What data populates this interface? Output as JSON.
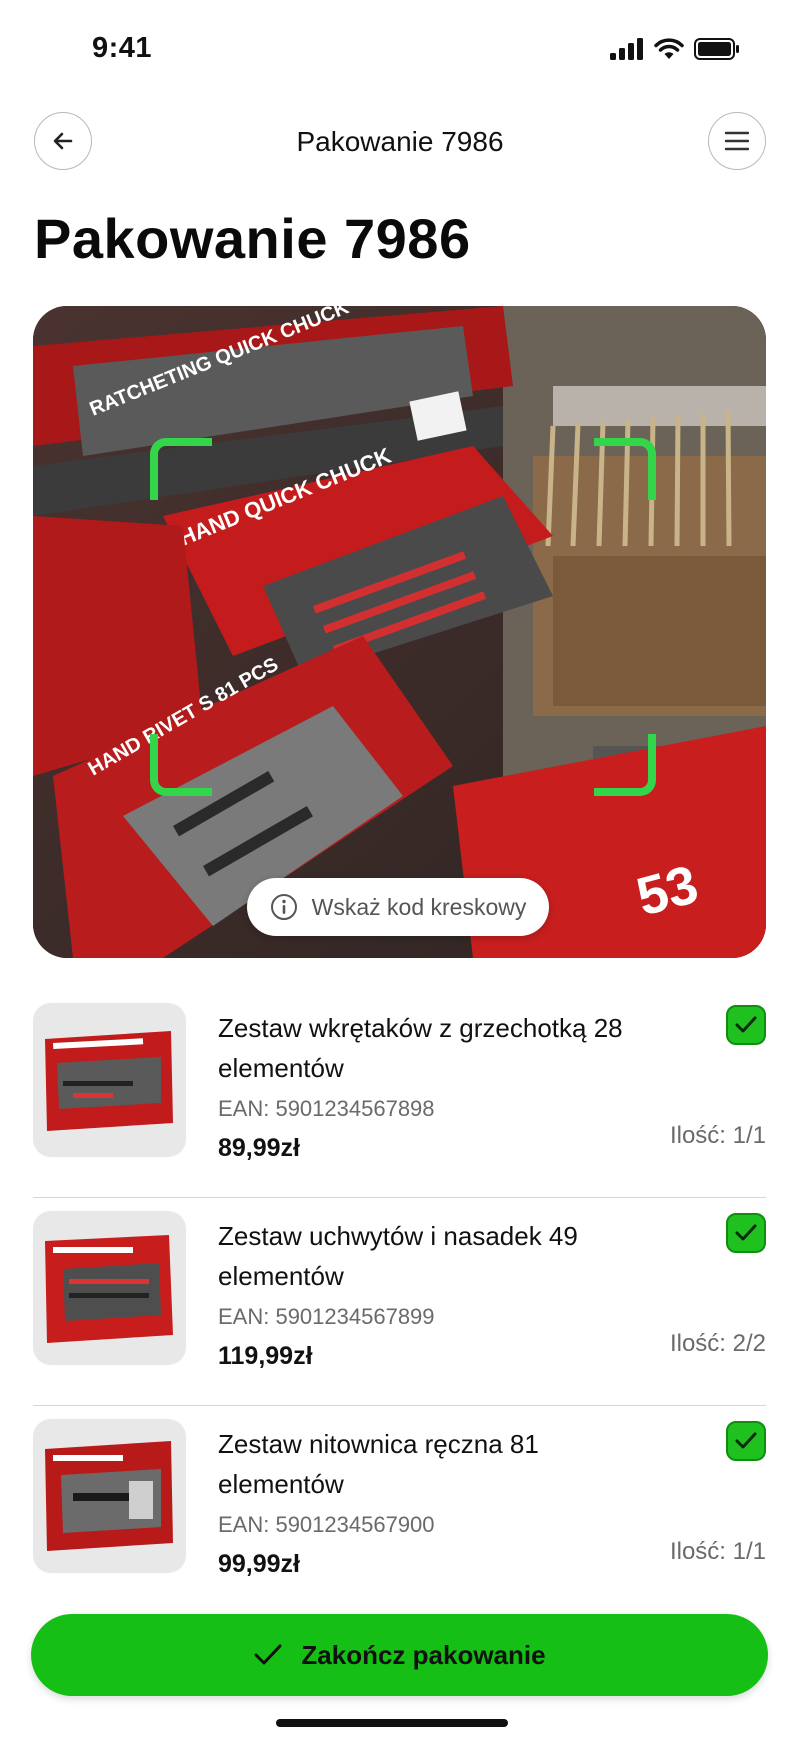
{
  "status_bar": {
    "time": "9:41"
  },
  "nav": {
    "title": "Pakowanie 7986"
  },
  "page": {
    "title": "Pakowanie 7986"
  },
  "scanner": {
    "hint": "Wskaż kod kreskowy"
  },
  "products": [
    {
      "name": "Zestaw wkrętaków z grzechotką 28 elementów",
      "ean": "EAN: 5901234567898",
      "price": "89,99zł",
      "qty": "Ilość: 1/1",
      "checked": true
    },
    {
      "name": "Zestaw uchwytów i nasadek 49 elementów",
      "ean": "EAN: 5901234567899",
      "price": "119,99zł",
      "qty": "Ilość: 2/2",
      "checked": true
    },
    {
      "name": "Zestaw nitownica ręczna 81 elementów",
      "ean": "EAN: 5901234567900",
      "price": "99,99zł",
      "qty": "Ilość: 1/1",
      "checked": true
    }
  ],
  "actions": {
    "finish_label": "Zakończ pakowanie"
  },
  "colors": {
    "accent": "#16BF16",
    "scan_frame": "#33D64A",
    "check": "#1FC11F"
  },
  "icons": [
    "signal-icon",
    "wifi-icon",
    "battery-icon",
    "arrow-left-icon",
    "menu-icon",
    "info-icon",
    "checkmark-icon"
  ]
}
